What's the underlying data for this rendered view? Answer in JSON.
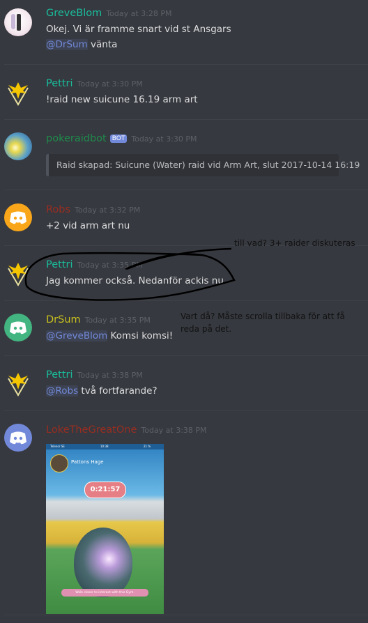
{
  "messages": [
    {
      "author": "GreveBlom",
      "author_color": "#1abc9c",
      "timestamp": "Today at 3:28 PM",
      "lines": [
        "Okej. Vi är framme snart vid st Ansgars"
      ],
      "mention": "@DrSum",
      "after_mention": " vänta"
    },
    {
      "author": "Pettri",
      "author_color": "#1abc9c",
      "timestamp": "Today at 3:30 PM",
      "text": "!raid new suicune 16.19 arm art"
    },
    {
      "author": "pokeraidbot",
      "author_color": "#1f8b4c",
      "badge": "BOT",
      "timestamp": "Today at 3:30 PM",
      "embed": "Raid skapad: Suicune (Water) raid vid Arm Art, slut 2017-10-14 16:19"
    },
    {
      "author": "Robs",
      "author_color": "#992d22",
      "timestamp": "Today at 3:32 PM",
      "text": "+2 vid arm art nu"
    },
    {
      "author": "Pettri",
      "author_color": "#1abc9c",
      "timestamp": "Today at 3:35 PM",
      "text": "Jag kommer också. Nedanför ackis nu"
    },
    {
      "author": "DrSum",
      "author_color": "#c9c11d",
      "timestamp": "Today at 3:35 PM",
      "mention": "@GreveBlom",
      "after_mention": " Komsi komsi!"
    },
    {
      "author": "Pettri",
      "author_color": "#1abc9c",
      "timestamp": "Today at 3:38 PM",
      "mention": "@Robs",
      "after_mention": " två fortfarande?"
    },
    {
      "author": "LokeTheGreatOne",
      "author_color": "#992d22",
      "timestamp": "Today at 3:38 PM",
      "attachment": {
        "carrier": "Telenor SE",
        "time": "10:38",
        "battery": "21 %",
        "gym": "Pattons Hage",
        "timer": "0:21:57",
        "hint": "Walk closer to interact with this Gym."
      }
    }
  ],
  "annotations": {
    "note1": "till vad? 3+ raider diskuteras",
    "note2_line1": "Vart då? Måste scrolla tillbaka för att få",
    "note2_line2": "reda på det."
  },
  "icons": {
    "team": "instinct-logo-icon",
    "discord": "discord-logo-icon"
  }
}
